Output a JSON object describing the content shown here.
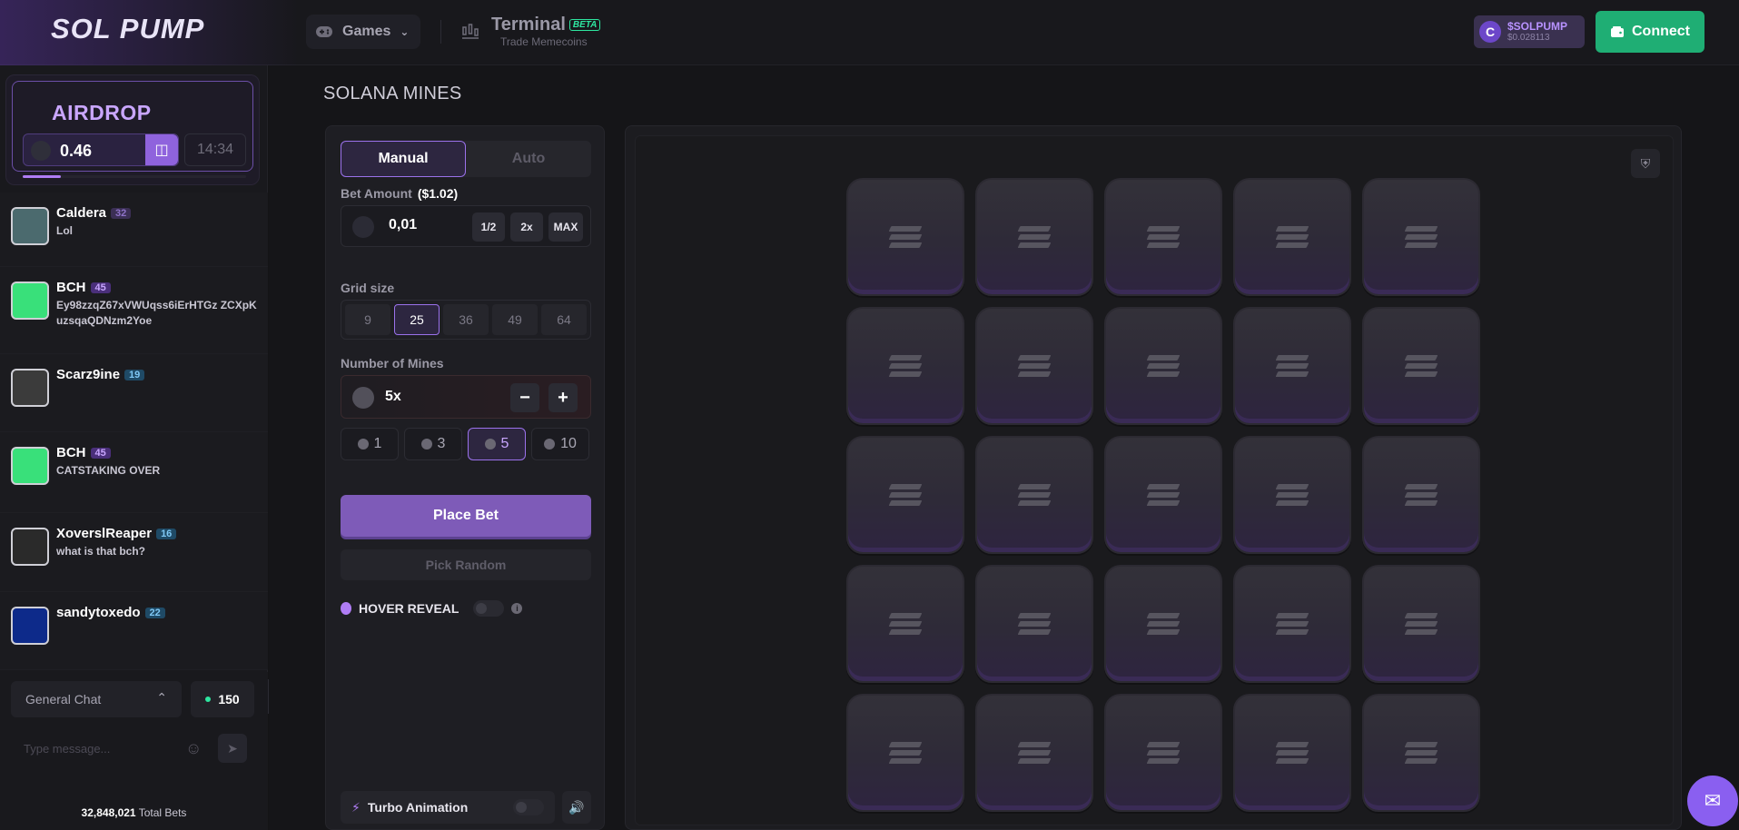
{
  "header": {
    "logo": "SOL PUMP",
    "games_label": "Games",
    "terminal_label": "Terminal",
    "terminal_badge": "BETA",
    "terminal_sub": "Trade Memecoins",
    "token_name": "$SOLPUMP",
    "token_price": "$0.028113",
    "connect_label": "Connect"
  },
  "airdrop": {
    "title": "AIRDROP",
    "amount": "0.46",
    "timer": "14:34",
    "progress": 0.17
  },
  "chat": {
    "messages": [
      {
        "name": "Caldera",
        "level": "32",
        "text": "Lol",
        "level_color": "#3b2f55",
        "level_text_color": "#8f73c9"
      },
      {
        "name": "BCH",
        "level": "45",
        "text": "Ey98zzqZ67xVWUqss6iErHTGz ZCXpKuzsqaQDNzm2Yoe",
        "level_color": "#4a2f7a",
        "level_text_color": "#c9a6ff"
      },
      {
        "name": "Scarz9ine",
        "level": "19",
        "text": "",
        "level_color": "#1f4a66",
        "level_text_color": "#7fc8f5"
      },
      {
        "name": "BCH",
        "level": "45",
        "text": "CATSTAKING OVER",
        "level_color": "#4a2f7a",
        "level_text_color": "#c9a6ff"
      },
      {
        "name": "XoverslReaper",
        "level": "16",
        "text": "what is that bch?",
        "level_color": "#1f4a66",
        "level_text_color": "#7fc8f5"
      },
      {
        "name": "sandytoxedo",
        "level": "22",
        "text": "",
        "level_color": "#1f4a66",
        "level_text_color": "#7fc8f5"
      }
    ],
    "channel": "General Chat",
    "online": "150",
    "placeholder": "Type message...",
    "total_bets_count": "32,848,021",
    "total_bets_label": "Total Bets"
  },
  "game": {
    "title": "SOLANA MINES",
    "tabs": [
      "Manual",
      "Auto"
    ],
    "bet_amount_label": "Bet Amount",
    "bet_amount_usd": "($1.02)",
    "bet_value": "0,01",
    "bet_half": "1/2",
    "bet_double": "2x",
    "bet_max": "MAX",
    "grid_size_label": "Grid size",
    "grid_options": [
      "9",
      "25",
      "36",
      "49",
      "64"
    ],
    "grid_selected": "25",
    "mines_label": "Number of Mines",
    "mines_value": "5x",
    "mines_quick": [
      "1",
      "3",
      "5",
      "10"
    ],
    "mines_selected": "5",
    "place_bet": "Place Bet",
    "pick_random": "Pick Random",
    "hover_reveal": "HOVER REVEAL",
    "turbo": "Turbo Animation",
    "grid_rows": 5,
    "grid_cols": 5
  }
}
